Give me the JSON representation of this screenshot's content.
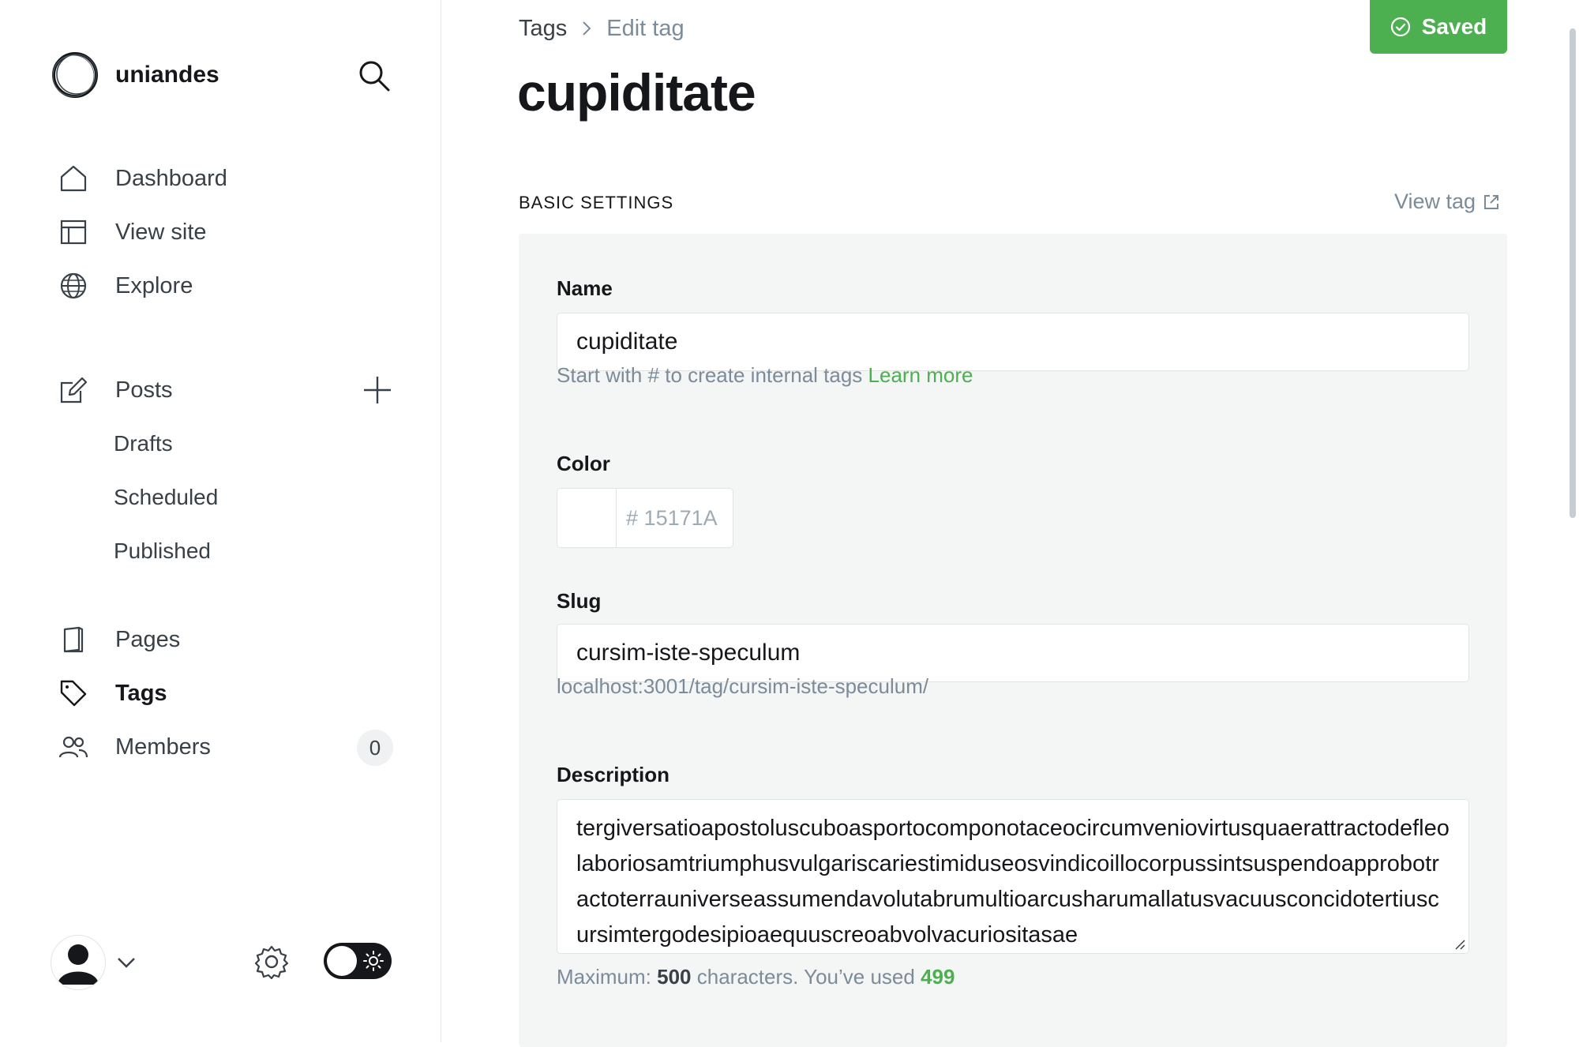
{
  "sidebar": {
    "brand_name": "uniandes",
    "nav": {
      "dashboard": "Dashboard",
      "view_site": "View site",
      "explore": "Explore",
      "posts": "Posts",
      "drafts": "Drafts",
      "scheduled": "Scheduled",
      "published": "Published",
      "pages": "Pages",
      "tags": "Tags",
      "members": "Members",
      "members_count": "0"
    },
    "icons": [
      "search-icon",
      "home-icon",
      "layout-icon",
      "globe-icon",
      "edit-icon",
      "plus-icon",
      "book-icon",
      "tag-icon",
      "users-icon",
      "user-icon",
      "chevron-down-icon",
      "gear-icon",
      "sun-icon"
    ]
  },
  "header": {
    "breadcrumb_parent": "Tags",
    "breadcrumb_current": "Edit tag",
    "save_label": "Saved",
    "title": "cupiditate"
  },
  "basic_settings": {
    "heading": "BASIC SETTINGS",
    "view_tag": "View tag",
    "name_label": "Name",
    "name_value": "cupiditate",
    "name_hint": "Start with # to create internal tags",
    "learn_more": "Learn more",
    "color_label": "Color",
    "color_hash": "#",
    "color_value": "15171A",
    "slug_label": "Slug",
    "slug_value": "cursim-iste-speculum",
    "slug_url": "localhost:3001/tag/cursim-iste-speculum/",
    "description_label": "Description",
    "description_value": "tergiversatioapostoluscuboasportocomponotaceocircumveniovirtusquaerattractodefleolaboriosamtriumphusvulgariscariestimiduseosvindicoillocorpussintsuspendoapprobotractoterrauniverseassumendavolutabrumultioarcusharumallatusvacuusconcidotertiuscursimtergodesipioaequuscreoabvolvacuriositasae",
    "max_prefix": "Maximum:",
    "max_value": "500",
    "used_prefix": "characters. You’ve used",
    "used_value": "499"
  },
  "colors": {
    "accent_green": "#4caf50",
    "text_dark": "#15171a",
    "text_muted": "#7c8b9a",
    "panel_bg": "#f4f5f5"
  }
}
